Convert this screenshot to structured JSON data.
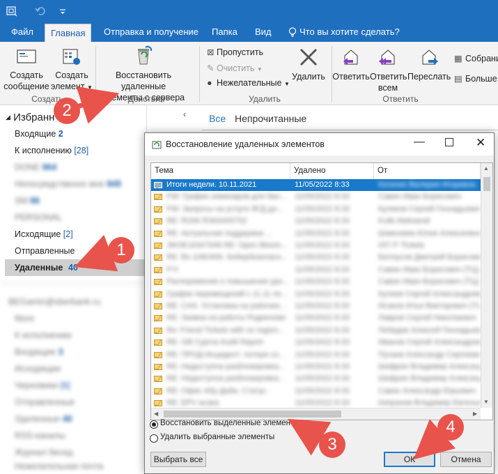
{
  "ribbon_tabs": [
    "Файл",
    "Главная",
    "Отправка и получение",
    "Папка",
    "Вид",
    "Что вы хотите сделать?"
  ],
  "ribbon": {
    "new_message": [
      "Создать",
      "сообщение"
    ],
    "new_item": [
      "Создать",
      "элемент"
    ],
    "group_create": "Создать",
    "restore": [
      "Восстановить удаленные",
      "элементы с сервера"
    ],
    "group_actions": "Действия",
    "ignore": "Пропустить",
    "clean": "Очистить",
    "junk": "Нежелательные",
    "delete": "Удалить",
    "group_delete": "Удалить",
    "reply": "Ответить",
    "reply_all": [
      "Ответить",
      "всем"
    ],
    "forward": "Переслать",
    "group_reply": "Ответить",
    "meeting": "Собрани",
    "more": "Больше"
  },
  "nav": {
    "favorites": "Избранн",
    "items": [
      {
        "label": "Входящие",
        "count": "2"
      },
      {
        "label": "К исполнению",
        "count": "[28]"
      },
      {
        "label": "DONE",
        "count": "964"
      },
      {
        "label": "Непосредственно мне",
        "count": "845"
      },
      {
        "label": "SM",
        "count": "86"
      },
      {
        "label": "PERSONAL",
        "count": ""
      },
      {
        "label": "Исходящие",
        "count": "[2]"
      },
      {
        "label": "Отправленные",
        "count": ""
      },
      {
        "label": "Удаленные",
        "count": "40"
      }
    ],
    "account": "BEGamin@sberbank.ru",
    "account_items": [
      {
        "label": "More",
        "count": ""
      },
      {
        "label": "К исполнению",
        "count": ""
      },
      {
        "label": "Входящие",
        "count": "3"
      },
      {
        "label": "Исходящие",
        "count": ""
      },
      {
        "label": "Черновики",
        "count": "[6]"
      },
      {
        "label": "Отправленные",
        "count": ""
      },
      {
        "label": "Удаленные",
        "count": "40"
      },
      {
        "label": "RSS-каналы",
        "count": ""
      },
      {
        "label": "Журнал бесед",
        "count": ""
      },
      {
        "label": "Нежелательная почта",
        "count": ""
      }
    ]
  },
  "list": {
    "all": "Все",
    "unread": "Непрочитанные"
  },
  "dialog": {
    "title": "Восстановление удаленных элементов",
    "col_subject": "Тема",
    "col_deleted": "Удалено",
    "col_from": "От",
    "rows": [
      {
        "subject": "Итоги недели. 10.11.2021",
        "deleted": "11/05/2022 8:33",
        "from": "Косенко Валерия Игоревна"
      },
      {
        "subject": "FW: График семинаров для бан...",
        "deleted": "11/05/2022 8:33",
        "from": "Савин Иван Борисович"
      },
      {
        "subject": "FW: Запросы на услуги ФГД до...",
        "deleted": "11/05/2022 8:33",
        "from": "Куликов Сергей Геннадьевич"
      },
      {
        "subject": "RE: R206 ЯЭ00005752",
        "deleted": "11/05/2022 8:33",
        "from": "Kulik Aleksandr"
      },
      {
        "subject": "RE: Актуальная поддержка ...",
        "deleted": "11/05/2022 8:33",
        "from": "Шамсиева Юлия Алексеевна"
      },
      {
        "subject": "ЭКОЕ16347648 RE: Open Bloom...",
        "deleted": "11/05/2022 8:33",
        "from": "ОП IT Tickets"
      },
      {
        "subject": "RE: Вх-1060406. Кибербезопасн...",
        "deleted": "11/05/2022 8:33",
        "from": "Белоусов Дмитрий Борисович"
      },
      {
        "subject": "FYI",
        "deleted": "11/05/2022 8:33",
        "from": "Савин Иван Борисович (ТЦ)"
      },
      {
        "subject": "Распоряжение о повышении уро...",
        "deleted": "11/05/2022 8:33",
        "from": "Савин Иван Борисович (ТЦ)"
      },
      {
        "subject": "График перемещений с 11.11 по...",
        "deleted": "11/05/2022 8:33",
        "from": "Кулиев Сергей Александрович"
      },
      {
        "subject": "RE: CAS. Установка на рабочее...",
        "deleted": "11/05/2022 8:33",
        "from": "Исаков Илья Викторович (ТЦ)"
      },
      {
        "subject": "RE: Заявка на работы Родионово",
        "deleted": "11/05/2022 8:33",
        "from": "Лавров Сергей Николаевич"
      },
      {
        "subject": "Re: Friend Tickets with no region...",
        "deleted": "11/05/2022 8:33",
        "from": "Лебедев Алексей Геннадьевич"
      },
      {
        "subject": "RE: GB Cyprus Audit Report",
        "deleted": "11/05/2022 8:33",
        "from": "Иванов Сергей Александрович"
      },
      {
        "subject": "RE: ПРОД Инцидент: потеря со...",
        "deleted": "11/05/2022 8:33",
        "from": "Пухаев Александр Сергеевич"
      },
      {
        "subject": "RE: Недоступна разблокировка...",
        "deleted": "11/05/2022 8:33",
        "from": "Шифрин Владимир Александрович"
      },
      {
        "subject": "RE: Недоступна разблокировка...",
        "deleted": "11/05/2022 8:33",
        "from": "Шифрин Владимир Александрович"
      },
      {
        "subject": "RE: Офис Абу-Даби. Статус.",
        "deleted": "11/05/2022 8:33",
        "from": "Савин Александр Юрьевич"
      },
      {
        "subject": "RE: EPV асака",
        "deleted": "11/05/2022 8:33",
        "from": "Капранов Владимир Евгеньевич"
      }
    ],
    "opt_restore": "Восстановить выделенные элементы",
    "opt_purge": "Удалить выбранные элементы",
    "select_all": "Выбрать все",
    "ok": "ОК",
    "cancel": "Отмена"
  },
  "annotations": [
    "1",
    "2",
    "3",
    "4"
  ],
  "colors": {
    "accent": "#1f6fbf",
    "selection": "#1979ca",
    "annotation": "#e8534b"
  }
}
